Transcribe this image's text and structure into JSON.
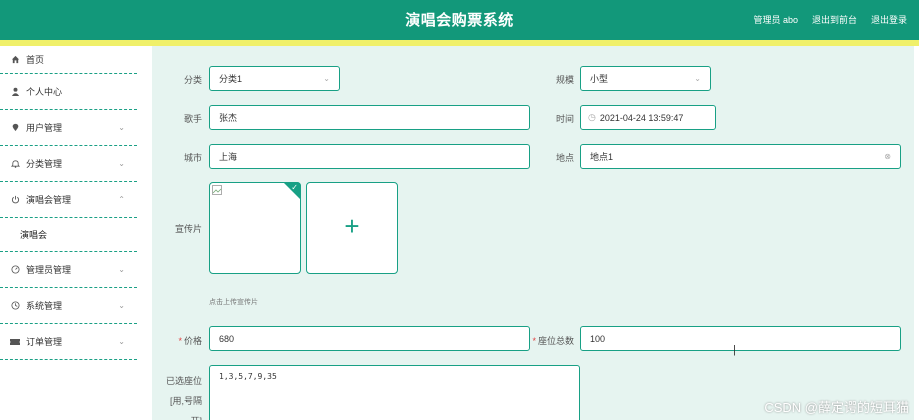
{
  "header": {
    "title": "演唱会购票系统",
    "admin_label": "管理员 abo",
    "back_label": "退出到前台",
    "logout_label": "退出登录"
  },
  "sidebar": {
    "home": "首页",
    "items": [
      {
        "label": "个人中心",
        "icon": "user-icon"
      },
      {
        "label": "用户管理",
        "icon": "location-pin-icon"
      },
      {
        "label": "分类管理",
        "icon": "bell-icon"
      },
      {
        "label": "演唱会管理",
        "icon": "power-icon"
      },
      {
        "label": "管理员管理",
        "icon": "gauge-icon"
      },
      {
        "label": "系统管理",
        "icon": "clock-icon"
      },
      {
        "label": "订单管理",
        "icon": "ticket-icon"
      }
    ],
    "sub_item": "演唱会"
  },
  "form": {
    "category": {
      "label": "分类",
      "value": "分类1"
    },
    "scale": {
      "label": "规模",
      "value": "小型"
    },
    "singer": {
      "label": "歌手",
      "value": "张杰"
    },
    "time": {
      "label": "时间",
      "value": "2021-04-24 13:59:47"
    },
    "city": {
      "label": "城市",
      "value": "上海"
    },
    "venue": {
      "label": "地点",
      "value": "地点1"
    },
    "poster": {
      "label": "宣传片",
      "hint": "点击上传宣传片"
    },
    "price": {
      "label": "价格",
      "value": "680"
    },
    "seats": {
      "label": "座位总数",
      "value": "100"
    },
    "selected_seats": {
      "label_lines": [
        "已选座位",
        "[用,号隔",
        "开]"
      ],
      "value": "1,3,5,7,9,35"
    }
  },
  "watermark": "CSDN @薛定谔的短耳猫",
  "colors": {
    "primary": "#12987a",
    "accent_stripe": "#f0f06a",
    "main_bg": "#e6f4f0"
  }
}
